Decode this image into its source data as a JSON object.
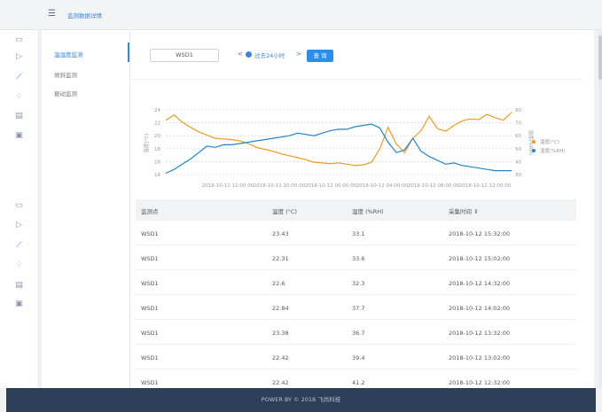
{
  "topbar": {
    "title": "监测数据详情"
  },
  "subnav": {
    "items": [
      "温湿度监测",
      "倾斜监测",
      "振动监测"
    ],
    "active": 0
  },
  "toolbar": {
    "device": "WSD1",
    "prev": "<",
    "range": "过去24小时",
    "next": ">",
    "query_label": "查 询"
  },
  "chart_data": {
    "type": "line",
    "x_tick_labels": [
      "2018-10-11 12:00:00",
      "2018-10-11 20:00:00",
      "2018-10-12 00:00:00",
      "2018-10-12 04:00:00",
      "2018-10-12 08:00:00",
      "2018-10-12 12:00:00"
    ],
    "y_left": {
      "label": "温度(°C)",
      "ticks": [
        14,
        16,
        18,
        20,
        22,
        24
      ],
      "range": [
        14,
        24
      ]
    },
    "y_right": {
      "label": "湿度(%RH)",
      "ticks": [
        30,
        40,
        50,
        60,
        70,
        80
      ],
      "range": [
        30,
        80
      ]
    },
    "series": [
      {
        "name": "温度(°C)",
        "axis": "left",
        "color": "#f39a1f",
        "values": [
          22.4,
          23.2,
          22.1,
          21.3,
          20.6,
          20.1,
          19.6,
          19.5,
          19.4,
          19.2,
          18.8,
          18.2,
          17.9,
          17.6,
          17.2,
          16.9,
          16.6,
          16.3,
          15.9,
          15.8,
          15.7,
          15.8,
          15.6,
          15.4,
          15.5,
          15.9,
          18.0,
          21.3,
          18.7,
          17.4,
          19.6,
          20.8,
          23.0,
          21.1,
          20.7,
          21.6,
          22.3,
          22.6,
          22.5,
          23.3,
          22.8,
          22.4,
          23.6
        ]
      },
      {
        "name": "湿度(%RH)",
        "axis": "right",
        "color": "#1f86d3",
        "values": [
          31,
          34,
          38,
          42,
          47,
          52,
          51,
          53,
          53,
          54,
          55,
          56,
          57,
          58,
          59,
          60,
          62,
          61,
          60,
          62,
          64,
          65,
          65,
          67,
          68,
          69,
          66,
          55,
          47,
          49,
          58,
          48,
          44,
          41,
          38,
          39,
          37,
          36,
          35,
          34,
          33,
          33,
          33
        ]
      }
    ],
    "legend_position": "right",
    "grid": true
  },
  "table": {
    "headers": [
      "监测点",
      "温度 (°C)",
      "湿度 (%RH)",
      "采集时间 ⇕"
    ],
    "rows": [
      [
        "WSD1",
        "23.43",
        "33.1",
        "2018-10-12 15:32:00"
      ],
      [
        "WSD1",
        "22.31",
        "33.6",
        "2018-10-12 15:02:00"
      ],
      [
        "WSD1",
        "22.6",
        "32.3",
        "2018-10-12 14:32:00"
      ],
      [
        "WSD1",
        "22.84",
        "37.7",
        "2018-10-12 14:02:00"
      ],
      [
        "WSD1",
        "23.38",
        "36.7",
        "2018-10-12 13:32:00"
      ],
      [
        "WSD1",
        "22.42",
        "39.4",
        "2018-10-12 13:02:00"
      ],
      [
        "WSD1",
        "22.42",
        "41.2",
        "2018-10-12 12:32:00"
      ]
    ]
  },
  "footer": {
    "text": "POWER BY © 2018 飞尚科技"
  },
  "colors": {
    "accent": "#2b8ee8",
    "footer_bg": "#2c3e58"
  }
}
